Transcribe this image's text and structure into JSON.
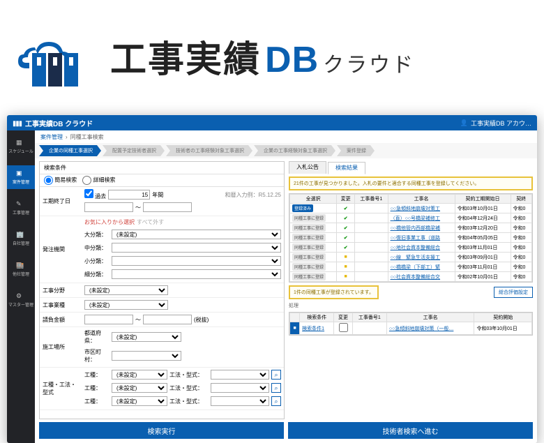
{
  "logo": {
    "main": "工事実績",
    "db": "DB",
    "sub": "クラウド"
  },
  "titlebar": {
    "title": "工事実績DB クラウド",
    "account": "工事実績DB アカウ…"
  },
  "sidebar": {
    "items": [
      {
        "label": "スケジュール",
        "icon": "calendar"
      },
      {
        "label": "案件管理",
        "icon": "folder",
        "active": true
      },
      {
        "label": "工事管理",
        "icon": "pencil"
      },
      {
        "label": "自社管理",
        "icon": "building"
      },
      {
        "label": "他社管理",
        "icon": "buildings"
      },
      {
        "label": "マスター管理",
        "icon": "gear"
      }
    ]
  },
  "breadcrumb": {
    "link": "案件管理",
    "current": "同種工事検索"
  },
  "wizard": [
    "企業の同種工事選択",
    "配置予定技術者選択",
    "技術者の工事経験対象工事選択",
    "企業の工事経験対象工事選択",
    "案件登録"
  ],
  "cond": {
    "title": "検索条件",
    "mode1": "簡易検索",
    "mode2": "詳細検索",
    "rows": {
      "period_end": {
        "label": "工期終了日",
        "chk": "過去",
        "num": "15",
        "unit": "年間",
        "hint": "和暦入力例：R5.12.25"
      },
      "fav": "お気に入りから選択",
      "all": "すべて外す",
      "order_org": {
        "label": "発注機関",
        "c1": "大分類：",
        "c2": "中分類：",
        "c3": "小分類：",
        "c4": "細分類：",
        "opt": "(未設定)"
      },
      "field": {
        "label": "工事分野",
        "opt": "(未設定)"
      },
      "type": {
        "label": "工事業種",
        "opt": "(未設定)"
      },
      "amount": {
        "label": "請負金額",
        "tilde": "～",
        "tax": "(税抜)"
      },
      "location": {
        "label": "施工場所",
        "pref": "都道府県：",
        "city": "市区町村：",
        "opt": "(未設定)"
      },
      "spec": {
        "label": "工種・工法・型式",
        "c1": "工種：",
        "c2": "工法・型式：",
        "opt": "(未設定)"
      }
    }
  },
  "tabs": {
    "t1": "入札公告",
    "t2": "検索結果"
  },
  "notice1": "21件の工事が見つかりました。入札の要件と適合する同種工事を登録してください。",
  "grid1": {
    "headers": [
      "全選択",
      "変更",
      "工事番号1",
      "工事名",
      "契約工期開始日",
      "契終"
    ],
    "rows": [
      {
        "btn": "登録済み",
        "btncls": "",
        "chk": true,
        "no": "",
        "name": "○○急傾斜地崩壊対策工",
        "date": "令和03年10月01日",
        "e": "令和0"
      },
      {
        "btn": "同種工事に登録",
        "btncls": "gray",
        "chk": true,
        "no": "",
        "name": "（直）○○号橋梁補修工",
        "date": "令和04年12月24日",
        "e": "令和0"
      },
      {
        "btn": "同種工事に登録",
        "btncls": "gray",
        "chk": true,
        "no": "",
        "name": "○○橋他管内西部橋梁補",
        "date": "令和03年12月20日",
        "e": "令和0"
      },
      {
        "btn": "同種工事に登録",
        "btncls": "gray",
        "chk": true,
        "no": "",
        "name": "○○復旧事業工事（道路",
        "date": "令和04年05月05日",
        "e": "令和0"
      },
      {
        "btn": "同種工事に登録",
        "btncls": "gray",
        "chk": true,
        "no": "",
        "name": "○○地社会資本整備総合",
        "date": "令和03年11月01日",
        "e": "令和0"
      },
      {
        "btn": "同種工事に登録",
        "btncls": "gray",
        "chk": false,
        "no": "",
        "name": "○○線　緊急生活支援工",
        "date": "令和03年09月01日",
        "e": "令和0"
      },
      {
        "btn": "同種工事に登録",
        "btncls": "gray",
        "chk": false,
        "no": "",
        "name": "○○橋橋梁（下部工）緊",
        "date": "令和03年11月01日",
        "e": "令和0"
      },
      {
        "btn": "同種工事に登録",
        "btncls": "gray",
        "chk": false,
        "no": "",
        "name": "○○社会資本整備総合交",
        "date": "令和02年10月01日",
        "e": "令和0"
      }
    ]
  },
  "notice2": "1件の同種工事が登録されています。",
  "eval_btn": "総合評価設定",
  "grid2": {
    "badge": "処理",
    "headers": [
      "",
      "検索条件",
      "変更",
      "工事番号1",
      "工事名",
      "契約開始"
    ],
    "rows": [
      {
        "del": "■",
        "cond": "検索条件1",
        "chg": "",
        "no": "",
        "name": "○○急傾斜地崩壊対策（一般…",
        "date": "令和03年10月01日"
      }
    ]
  },
  "bottom": {
    "b1": "検索実行",
    "b2": "技術者検索へ進む"
  }
}
